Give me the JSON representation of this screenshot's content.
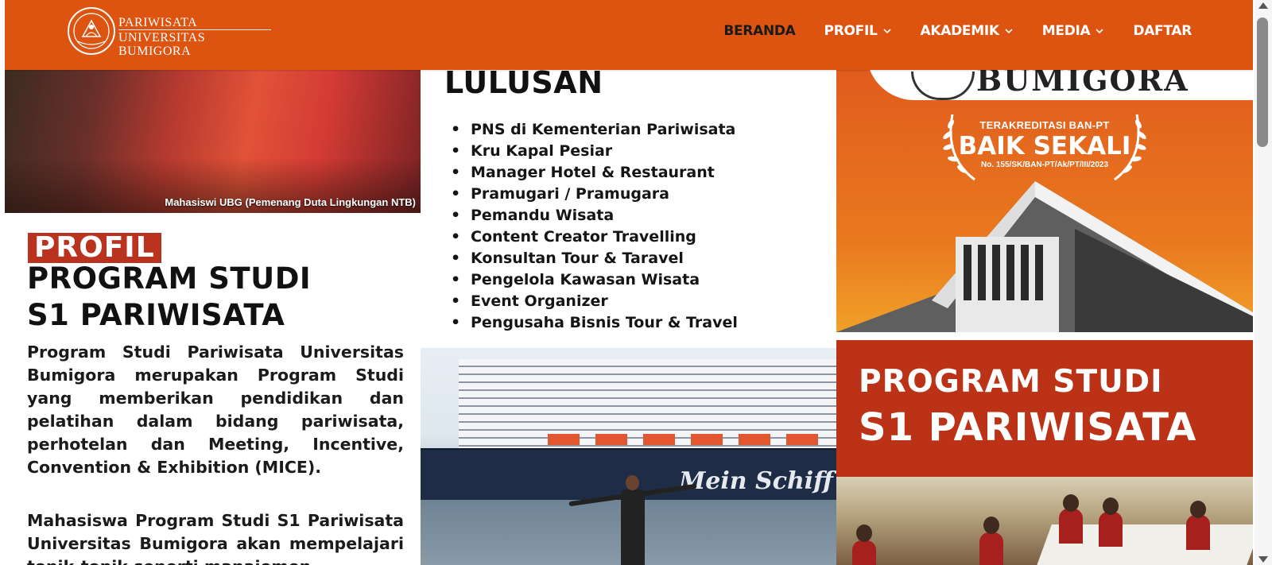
{
  "header": {
    "brand_line1": "PARIWISATA",
    "brand_line2": "UNIVERSITAS BUMIGORA",
    "logo_icon": "university-seal-logo",
    "nav": [
      {
        "label": "BERANDA",
        "dropdown": false,
        "active": true
      },
      {
        "label": "PROFIL",
        "dropdown": true
      },
      {
        "label": "AKADEMIK",
        "dropdown": true
      },
      {
        "label": "MEDIA",
        "dropdown": true
      },
      {
        "label": "DAFTAR",
        "dropdown": false
      }
    ],
    "colors": {
      "bar": "#dd5410",
      "active_text": "#1a1a1a",
      "text": "#ffffff"
    }
  },
  "profile_panel": {
    "photo_caption": "Mahasiswi UBG (Pemenang Duta Lingkungan NTB)",
    "badge": "PROFIL",
    "title_line1": "PROGRAM STUDI",
    "title_line2": "S1 PARIWISATA",
    "paragraph1": "Program Studi Pariwisata Universitas Bumigora merupakan Program Studi yang memberikan pendidikan dan pelatihan dalam bidang pariwisata, perhotelan dan Meeting, Incentive, Convention & Exhibition (MICE).",
    "paragraph2": "Mahasiswa Program Studi S1 Pariwisata Universitas Bumigora akan mempelajari topik-topik seperti manajemen"
  },
  "graduates_panel": {
    "heading": "LULUSAN",
    "careers": [
      "PNS di Kementerian Pariwisata",
      "Kru Kapal Pesiar",
      "Manager Hotel & Restaurant",
      "Pramugari / Pramugara",
      "Pemandu Wisata",
      "Content Creator Travelling",
      "Konsultan Tour & Taravel",
      "Pengelola Kawasan Wisata",
      "Event Organizer",
      "Pengusaha Bisnis Tour & Travel"
    ],
    "ship_name": "Mein Schiff"
  },
  "promo_panel": {
    "top_text": "BUMIGORA",
    "accreditation_label": "TERAKREDITASI BAN-PT",
    "accreditation_grade": "BAIK SEKALI",
    "accreditation_number": "No. 155/SK/BAN-PT/Ak/PT/III/2023",
    "title_line1": "PROGRAM STUDI",
    "title_line2": "S1 PARIWISATA",
    "colors": {
      "band": "#bb3216",
      "gradient_top": "#e15c1d",
      "gradient_bottom": "#f4b02d"
    }
  }
}
